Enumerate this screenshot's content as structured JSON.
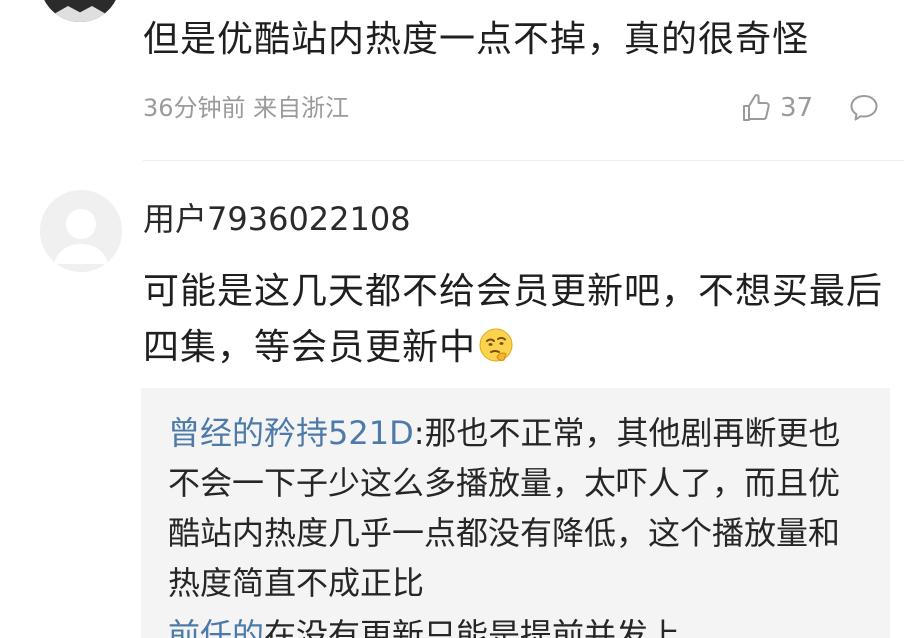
{
  "comment1": {
    "text": "但是优酷站内热度一点不掉，真的很奇怪",
    "meta": "36分钟前 来自浙江",
    "likes": "37"
  },
  "comment2": {
    "username": "用户7936022108",
    "text": "可能是这几天都不给会员更新吧，不想买最后四集，等会员更新中",
    "emoji": "thinking-face-emoji"
  },
  "reply": {
    "user": "曾经的矜持521D",
    "text": ":那也不正常，其他剧再断更也不会一下子少这么多播放量，太吓人了，而且优酷站内热度几乎一点都没有降低，这个播放量和热度简直不成正比",
    "next_user": "前任的",
    "next_text": "在没有更新只能是提前并发上..."
  },
  "colors": {
    "link": "#4d7aa8",
    "meta": "#9a9a9a",
    "reply_bg": "#f4f4f4"
  }
}
